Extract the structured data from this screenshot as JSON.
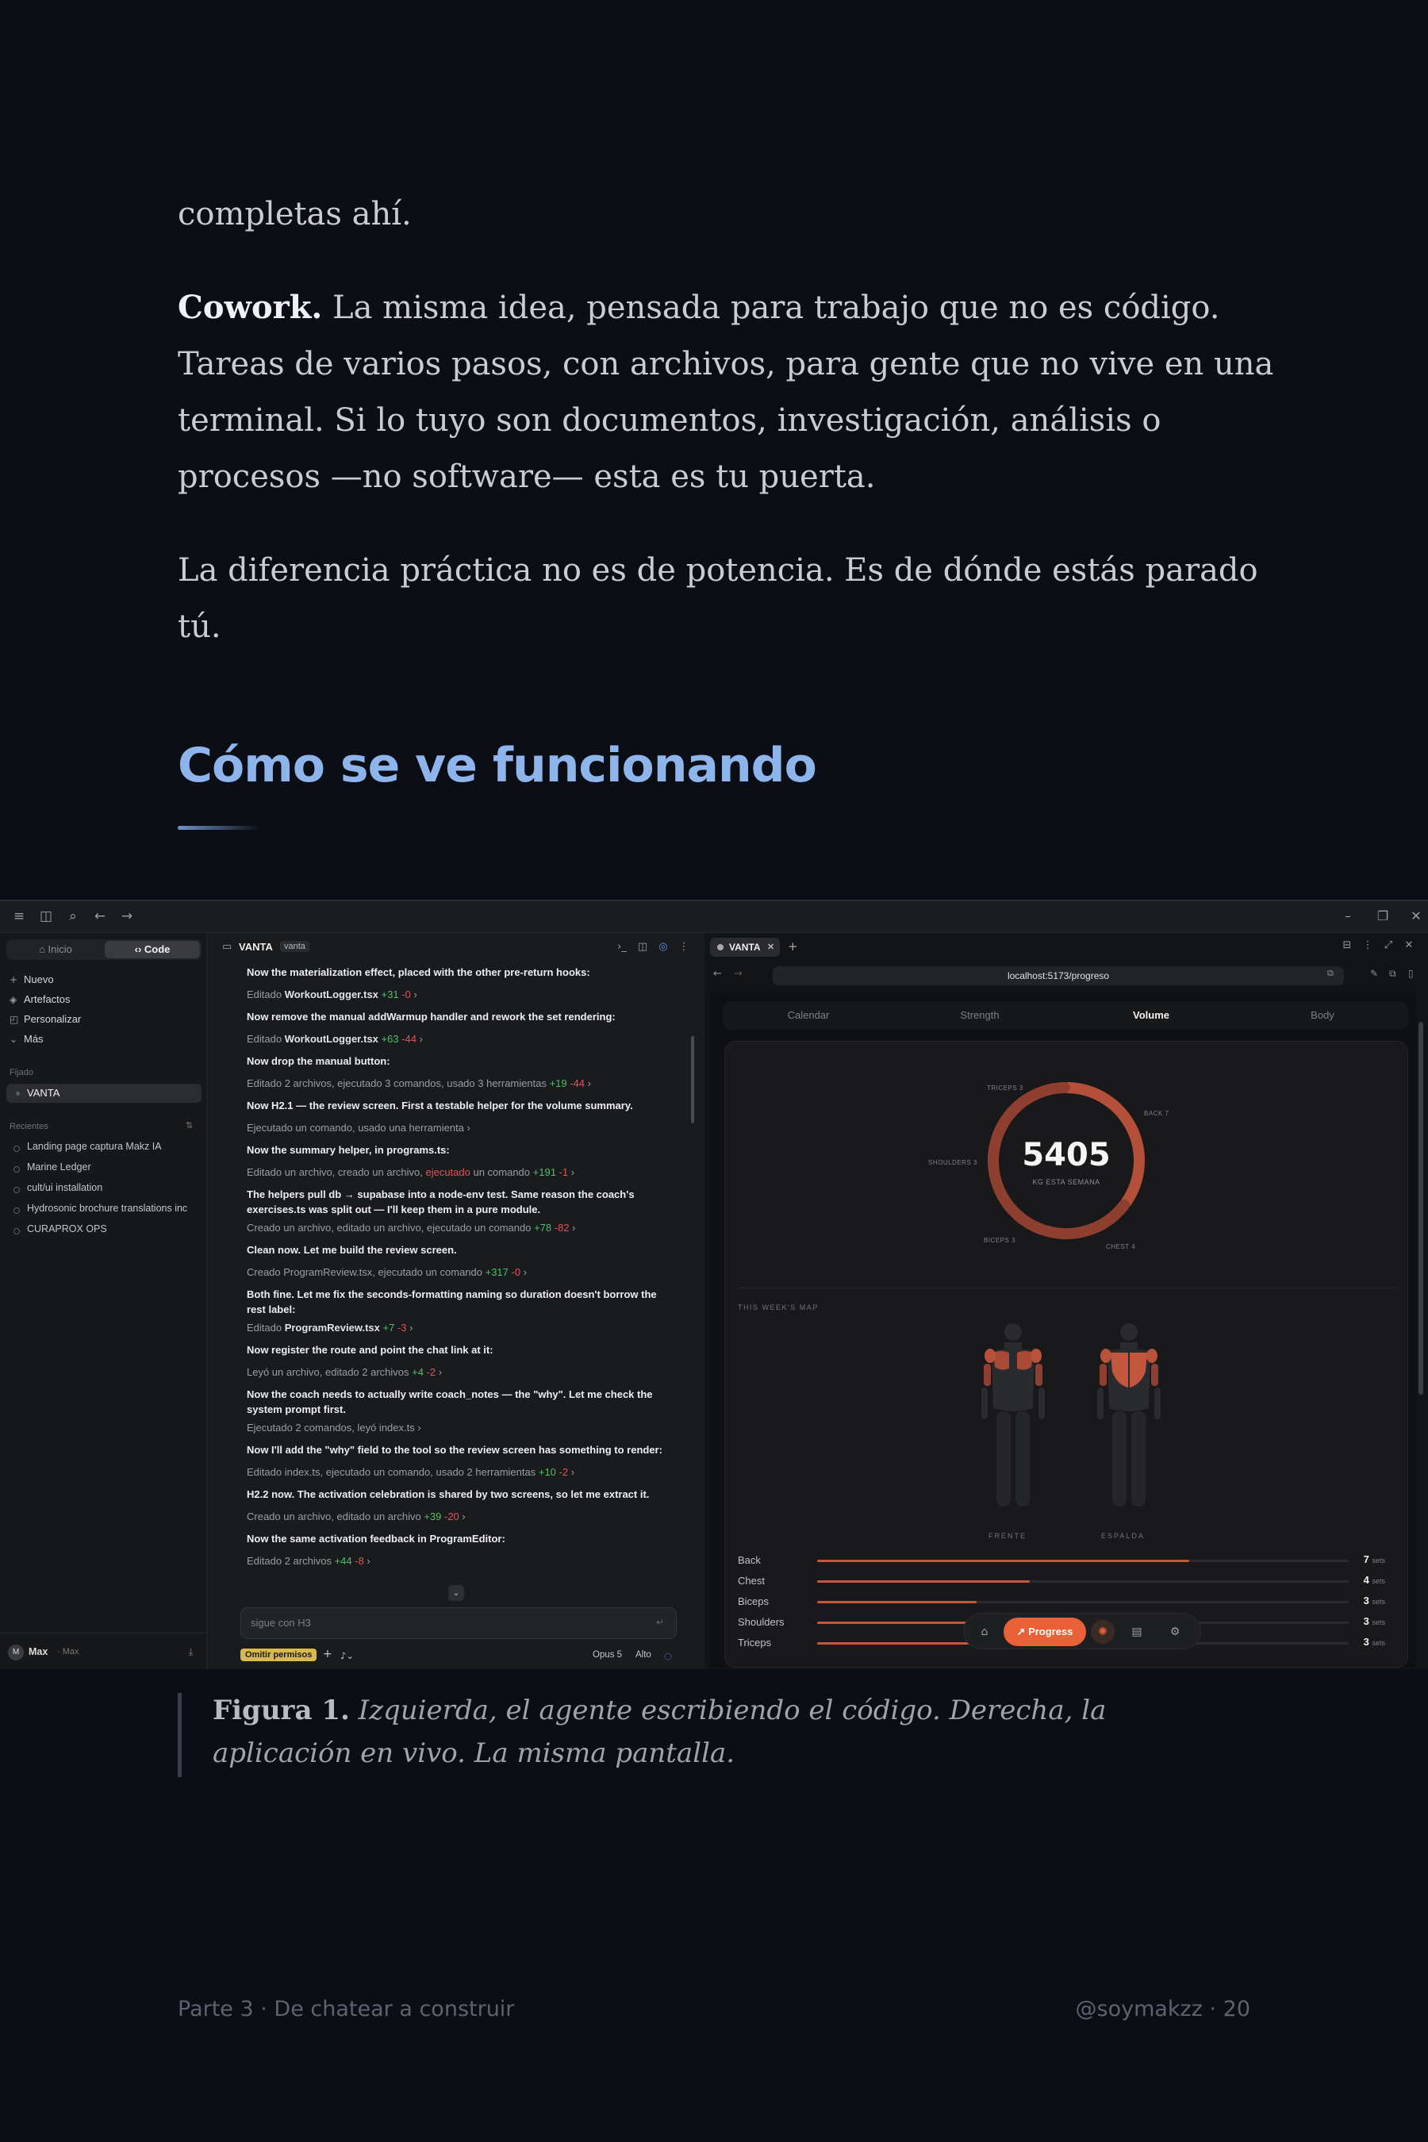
{
  "article": {
    "intro_tail": "completas ahí.",
    "cowork_bold": "Cowork.",
    "cowork_text": " La misma idea, pensada para trabajo que no es código. Tareas de varios pasos, con archivos, para gente que no vive en una terminal. Si lo tuyo son documentos, investigación, análisis o procesos —no software— esta es tu puerta.",
    "difference": "La diferencia práctica no es de potencia. Es de dónde estás parado tú.",
    "section_heading": "Cómo se ve funcionando"
  },
  "screenshot": {
    "sidebar": {
      "tab_home": "Inicio",
      "tab_code": "Code",
      "actions": [
        {
          "label": "Nuevo",
          "icon": "plus-icon"
        },
        {
          "label": "Artefactos",
          "icon": "artifacts-icon"
        },
        {
          "label": "Personalizar",
          "icon": "customize-icon"
        },
        {
          "label": "Más",
          "icon": "chevron-down-icon"
        }
      ],
      "pinned_label": "Fijado",
      "pinned_item": "VANTA",
      "recents_label": "Recientes",
      "recents": [
        "Landing page captura Makz IA",
        "Marine Ledger",
        "cult/ui installation",
        "Hydrosonic brochure translations inc",
        "CURAPROX OPS"
      ],
      "user_initial": "M",
      "user_name": "Max",
      "user_sub": "· Max"
    },
    "chat": {
      "title": "VANTA",
      "badge": "vanta",
      "lines": [
        {
          "k": "b",
          "t": "Now the materialization effect, placed with the other pre-return hooks:"
        },
        {
          "k": "e",
          "pre": "Editado ",
          "file": "WorkoutLogger.tsx",
          "add": " +31",
          "del": " -0",
          "post": " ›"
        },
        {
          "k": "b",
          "t": "Now remove the manual addWarmup handler and rework the set rendering:"
        },
        {
          "k": "e",
          "pre": "Editado ",
          "file": "WorkoutLogger.tsx",
          "add": " +63",
          "del": " -44",
          "post": " ›"
        },
        {
          "k": "b",
          "t": "Now drop the manual button:"
        },
        {
          "k": "e",
          "pre": "Editado 2 archivos, ejecutado 3 comandos, usado 3 herramientas",
          "file": "",
          "add": " +19",
          "del": " -44",
          "post": " ›"
        },
        {
          "k": "b",
          "t": "Now H2.1 — the review screen. First a testable helper for the volume summary."
        },
        {
          "k": "g",
          "t": "Ejecutado un comando, usado una herramienta ›"
        },
        {
          "k": "b",
          "t": "Now the summary helper, in programs.ts:"
        },
        {
          "k": "e2",
          "pre": "Editado un archivo, creado un archivo, ",
          "err": "ejecutado",
          "mid": " un comando",
          "add": " +191",
          "del": " -1",
          "post": " ›"
        },
        {
          "k": "b",
          "t": "The helpers pull db → supabase into a node-env test. Same reason the coach's exercises.ts was split out — I'll keep them in a pure module."
        },
        {
          "k": "e",
          "pre": "Creado un archivo, editado un archivo, ejecutado un comando",
          "file": "",
          "add": " +78",
          "del": " -82",
          "post": " ›"
        },
        {
          "k": "b",
          "t": "Clean now. Let me build the review screen."
        },
        {
          "k": "e",
          "pre": "Creado ProgramReview.tsx, ejecutado un comando",
          "file": "",
          "add": " +317",
          "del": " -0",
          "post": " ›"
        },
        {
          "k": "b",
          "t": "Both fine. Let me fix the seconds-formatting naming so duration doesn't borrow the rest label:"
        },
        {
          "k": "e",
          "pre": "Editado ",
          "file": "ProgramReview.tsx",
          "add": " +7",
          "del": " -3",
          "post": " ›"
        },
        {
          "k": "b",
          "t": "Now register the route and point the chat link at it:"
        },
        {
          "k": "e",
          "pre": "Leyó un archivo, editado 2 archivos",
          "file": "",
          "add": " +4",
          "del": " -2",
          "post": " ›"
        },
        {
          "k": "b",
          "t": "Now the coach needs to actually write coach_notes — the \"why\". Let me check the system prompt first."
        },
        {
          "k": "g",
          "t": "Ejecutado 2 comandos, leyó index.ts ›"
        },
        {
          "k": "b",
          "t": "Now I'll add the \"why\" field to the tool so the review screen has something to render:"
        },
        {
          "k": "e",
          "pre": "Editado index.ts, ejecutado un comando, usado 2 herramientas",
          "file": "",
          "add": " +10",
          "del": " -2",
          "post": " ›"
        },
        {
          "k": "b",
          "t": "H2.2 now. The activation celebration is shared by two screens, so let me extract it."
        },
        {
          "k": "e",
          "pre": "Creado un archivo, editado un archivo",
          "file": "",
          "add": " +39",
          "del": " -20",
          "post": " ›"
        },
        {
          "k": "b",
          "t": "Now the same activation feedback in ProgramEditor:"
        },
        {
          "k": "e",
          "pre": "Editado 2 archivos",
          "file": "",
          "add": " +44",
          "del": " -8",
          "post": " ›"
        }
      ],
      "input_placeholder": "sigue con H3",
      "permissions": "Omitir permisos",
      "model": "Opus 5",
      "effort": "Alto"
    },
    "browser": {
      "tab_title": "VANTA",
      "url": "localhost:5173/progreso",
      "app_tabs": [
        "Calendar",
        "Strength",
        "Volume",
        "Body"
      ],
      "active_tab": "Volume",
      "ring_total": "5405",
      "ring_caption": "KG ESTA SEMANA",
      "ring_labels": {
        "triceps": "TRICEPS 3",
        "back": "BACK 7",
        "shoulders": "SHOULDERS 3",
        "biceps": "BICEPS 3",
        "chest": "CHEST 4"
      },
      "map_title": "THIS WEEK'S MAP",
      "front_label": "FRENTE",
      "back_label": "ESPALDA",
      "muscles": [
        {
          "name": "Back",
          "sets": 7,
          "unit": "sets",
          "fill": 0.7
        },
        {
          "name": "Chest",
          "sets": 4,
          "unit": "sets",
          "fill": 0.4
        },
        {
          "name": "Biceps",
          "sets": 3,
          "unit": "sets",
          "fill": 0.3
        },
        {
          "name": "Shoulders",
          "sets": 3,
          "unit": "sets",
          "fill": 0.3
        },
        {
          "name": "Triceps",
          "sets": 3,
          "unit": "sets",
          "fill": 0.3
        }
      ],
      "bottom_nav_progress": "Progress",
      "accent": "#ea6138"
    }
  },
  "caption": {
    "label": "Figura 1.",
    "text": " Izquierda, el agente escribiendo el código. Derecha, la aplicación en vivo. La misma pantalla."
  },
  "footer": {
    "left": "Parte 3 · De chatear a construir",
    "right": "@soymakzz · 20"
  }
}
